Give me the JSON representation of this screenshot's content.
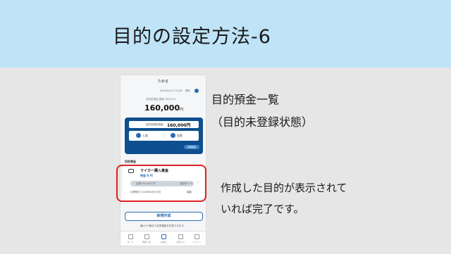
{
  "header": {
    "title": "目的の設定方法-6"
  },
  "phone": {
    "title": "ためる",
    "datetime": "2024/01/17 12:00",
    "refresh_label": "現在",
    "balance_label": "未設定残高 普通 7654321",
    "balance_value": "160,000",
    "balance_unit": "円",
    "card": {
      "unassigned_label": "目的未設定残高",
      "unassigned_value": "160,000",
      "unassigned_unit": "円",
      "deposit_label": "入金",
      "withdraw_label": "出金",
      "detail_label": "明細履歴"
    },
    "section_label": "目的預金",
    "goal": {
      "name": "マイカー購入資金",
      "amount": "残金 0 円",
      "target": "目標 500,000 円",
      "percent": "達成率 0 %",
      "date": "目標期日 2026年06月30日",
      "edit": "編集"
    },
    "new_button": "新規作成",
    "note": "最大で9個まで目的預金を作成できます。",
    "tabs": [
      {
        "label": "ホーム",
        "icon": "home-icon"
      },
      {
        "label": "明細一覧",
        "icon": "list-icon"
      },
      {
        "label": "ためる",
        "icon": "save-icon"
      },
      {
        "label": "お知らせ",
        "icon": "bell-icon"
      },
      {
        "label": "メニュー",
        "icon": "menu-icon"
      }
    ]
  },
  "side": {
    "title_line1": "目的預金一覧",
    "title_line2": "（目的未登録状態）",
    "desc_line1": "作成した目的が表示されて",
    "desc_line2": "いれば完了です。"
  },
  "colors": {
    "header_bg": "#bfe3f7",
    "card_blue": "#0e4f8f",
    "highlight_red": "#e02020"
  }
}
